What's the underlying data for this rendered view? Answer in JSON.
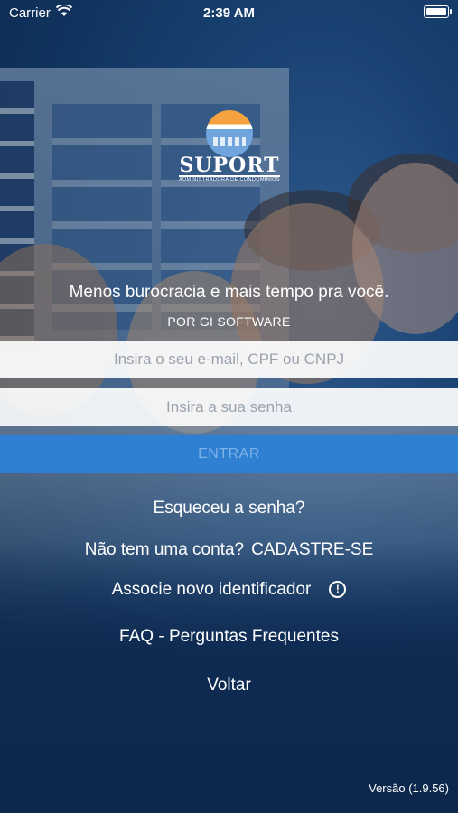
{
  "status_bar": {
    "carrier": "Carrier",
    "time": "2:39 AM",
    "battery_level": 1.0
  },
  "brand": {
    "name": "SUPORT",
    "subtitle": "ADMINISTRADORA DE CONDOMÍNIOS"
  },
  "tagline": "Menos burocracia e mais tempo pra você.",
  "byline": "POR GI SOFTWARE",
  "login": {
    "email_placeholder": "Insira o seu e-mail, CPF ou CNPJ",
    "password_placeholder": "Insira a sua senha",
    "enter_label": "ENTRAR"
  },
  "links": {
    "forgot_password": "Esqueceu a senha?",
    "no_account": "Não tem uma conta?",
    "signup": "CADASTRE-SE",
    "associate": "Associe novo identificador",
    "associate_info_icon": "!",
    "faq": "FAQ - Perguntas Frequentes",
    "back": "Voltar"
  },
  "version": "Versão (1.9.56)",
  "colors": {
    "background": "#0f2b52",
    "enter_button": "#2f7fd2",
    "enter_text": "#7fb2e6"
  }
}
